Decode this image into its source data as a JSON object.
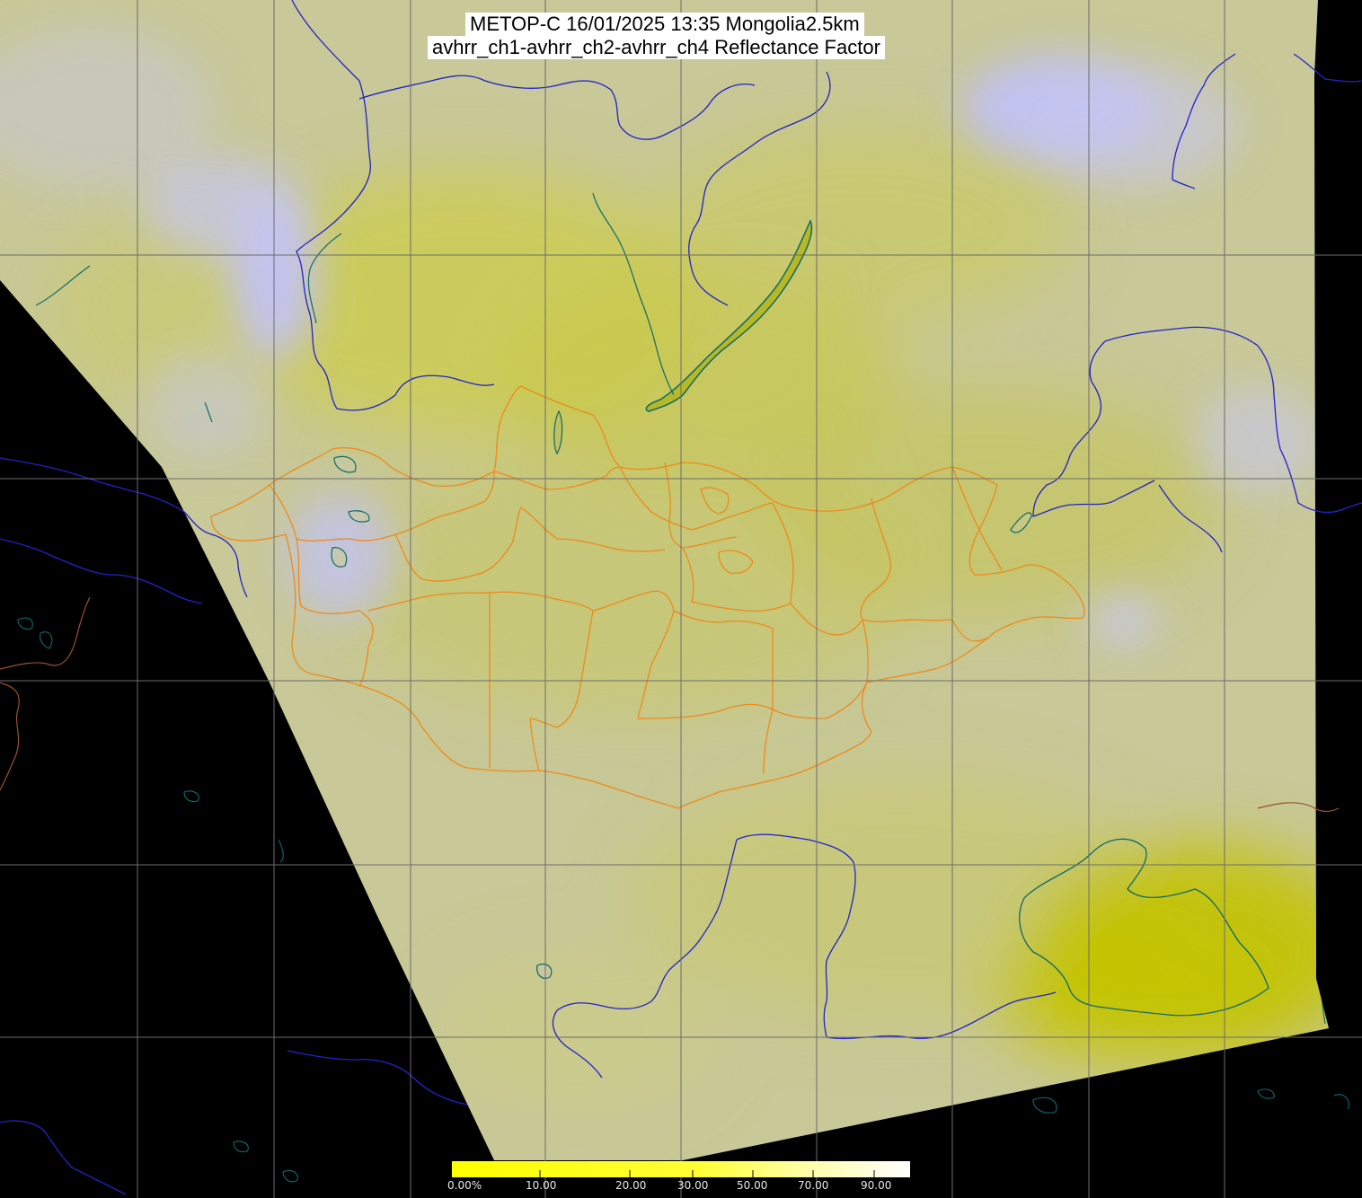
{
  "title": {
    "line1": "METOP-C 16/01/2025 13:35 Mongolia2.5km",
    "line2": "avhrr_ch1-avhrr_ch2-avhrr_ch4 Reflectance Factor"
  },
  "colorbar": {
    "labels": [
      "0.00%",
      "10.00",
      "20.00",
      "30.00",
      "50.00",
      "70.00",
      "90.00"
    ],
    "colors": [
      "#ffff00",
      "#ffff7a",
      "#ffffd0",
      "#ffffff"
    ]
  },
  "colors": {
    "background": "#000000",
    "land_base": "#c8c898",
    "cloud": "#c2c2f4",
    "haze_yellow": "#cccc4a",
    "deep_yellow": "#c2c200",
    "grid": "#6c6c6c",
    "national_border": "#2222cc",
    "admin_border": "#ee8a1a",
    "coastline": "#0e6a6a",
    "neighbor_border": "#9a5030"
  },
  "icons": {
    "map": "satellite-swath-map"
  }
}
